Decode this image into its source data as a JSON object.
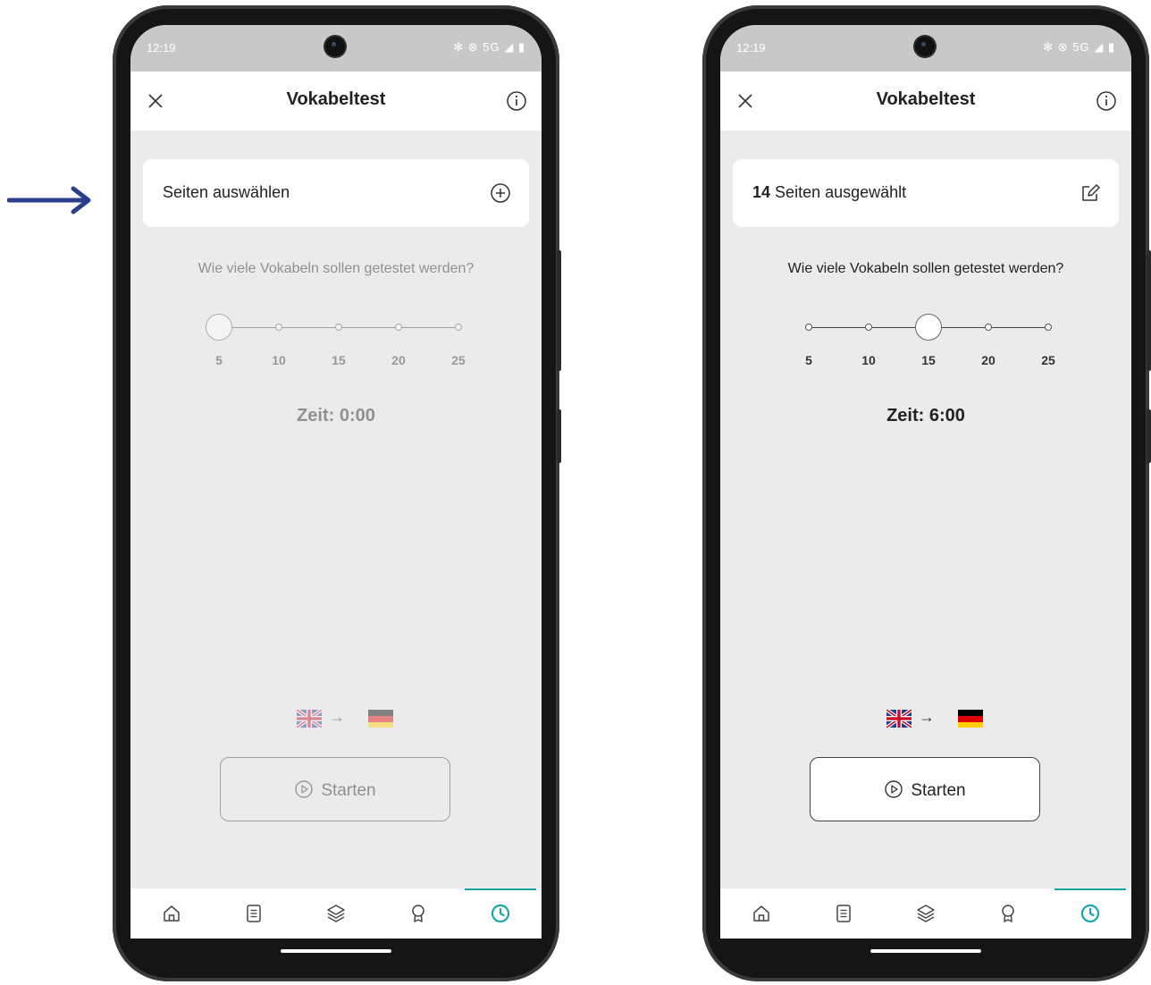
{
  "screens": [
    {
      "status_time": "12:19",
      "status_icons": "✻ ⊗ 5G ◢ ▮",
      "title": "Vokabeltest",
      "card": {
        "count": "",
        "label": "Seiten auswählen",
        "icon": "add-circle-icon"
      },
      "question": "Wie viele Vokabeln sollen getestet werden?",
      "slider": {
        "options": [
          "5",
          "10",
          "15",
          "20",
          "25"
        ],
        "selected": "5"
      },
      "time": "Zeit: 0:00",
      "direction": {
        "from": "flag-uk",
        "arrow": "→",
        "to": "flag-germany"
      },
      "start_label": "Starten",
      "start_disabled": true,
      "nav": [
        "home-icon",
        "document-icon",
        "layers-icon",
        "award-icon",
        "clock-icon"
      ],
      "nav_active": "clock-icon"
    },
    {
      "status_time": "12:19",
      "status_icons": "✻ ⊗ 5G ◢ ▮",
      "title": "Vokabeltest",
      "card": {
        "count": "14",
        "label": "Seiten ausgewählt",
        "icon": "edit-icon"
      },
      "question": "Wie viele Vokabeln sollen getestet werden?",
      "slider": {
        "options": [
          "5",
          "10",
          "15",
          "20",
          "25"
        ],
        "selected": "15"
      },
      "time": "Zeit: 6:00",
      "direction": {
        "from": "flag-uk",
        "arrow": "→",
        "to": "flag-germany"
      },
      "start_label": "Starten",
      "start_disabled": false,
      "nav": [
        "home-icon",
        "document-icon",
        "layers-icon",
        "award-icon",
        "clock-icon"
      ],
      "nav_active": "clock-icon"
    }
  ],
  "colors": {
    "accent": "#1aa5ab",
    "annotation_arrow": "#2c3e8c",
    "background": "#ebebeb"
  }
}
